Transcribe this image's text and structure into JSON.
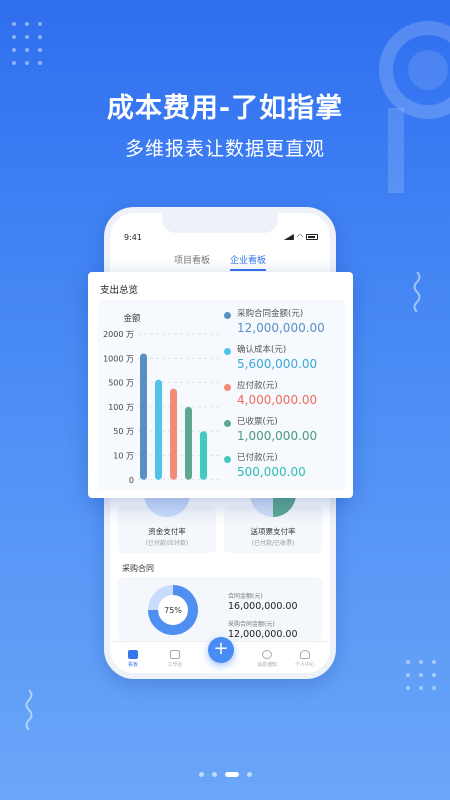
{
  "headline": "成本费用-了如指掌",
  "subline": "多维报表让数据更直观",
  "phone": {
    "status_time": "9:41",
    "tabs": [
      {
        "label": "项目看板",
        "active": false
      },
      {
        "label": "企业看板",
        "active": true
      }
    ],
    "rates": [
      {
        "title": "资金支付率",
        "sub": "(已付款/应付款)",
        "color": "#c9dcfb"
      },
      {
        "title": "送项票支付率",
        "sub": "(已付款/已收票)",
        "color": "#5ea88f"
      }
    ],
    "contract_section": {
      "title": "采购合同",
      "percent": "75%",
      "total_label": "合同金额(元)",
      "total_value": "16,000,000.00",
      "purchase_label": "采购合同金额(元)",
      "purchase_value": "12,000,000.00"
    },
    "tabbar": [
      {
        "label": "看板",
        "active": true,
        "icon": "dashboard-icon"
      },
      {
        "label": "工作台",
        "active": false,
        "icon": "workbench-icon"
      },
      {
        "label": "消息通知",
        "active": false,
        "icon": "message-icon"
      },
      {
        "label": "个人中心",
        "active": false,
        "icon": "profile-icon"
      }
    ],
    "fab_label": "+"
  },
  "card": {
    "title": "支出总览"
  },
  "chart_data": {
    "type": "bar",
    "ylabel": "金额",
    "y_ticks": [
      "2000 万",
      "1000 万",
      "500 万",
      "100 万",
      "50 万",
      "10 万",
      "0"
    ],
    "series": [
      {
        "name": "采购合同金额(元)",
        "display": "12,000,000.00",
        "value": 1200,
        "color": "#5a8fc4"
      },
      {
        "name": "确认成本(元)",
        "display": "5,600,000.00",
        "value": 560,
        "color": "#4fc3e8"
      },
      {
        "name": "应付款(元)",
        "display": "4,000,000.00",
        "value": 400,
        "color": "#f48a7a"
      },
      {
        "name": "已收票(元)",
        "display": "1,000,000.00",
        "value": 100,
        "color": "#5ea88f"
      },
      {
        "name": "已付款(元)",
        "display": "500,000.00",
        "value": 50,
        "color": "#42c9c0"
      }
    ],
    "legend_value_colors": [
      "#5a8fc4",
      "#3aa8d8",
      "#f06b5b",
      "#4a9a80",
      "#2fbdb2"
    ],
    "scale": "piecewise-log",
    "grid": true
  },
  "pager": {
    "count": 4,
    "active": 2
  }
}
